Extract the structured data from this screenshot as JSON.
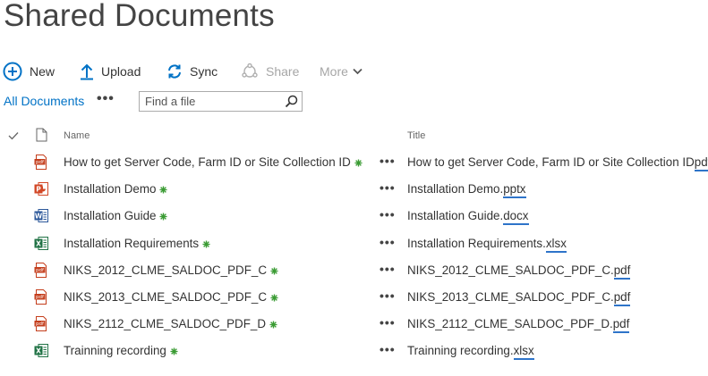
{
  "page": {
    "title": "Shared Documents"
  },
  "toolbar": {
    "new_label": "New",
    "upload_label": "Upload",
    "sync_label": "Sync",
    "share_label": "Share",
    "more_label": "More"
  },
  "view": {
    "all_documents": "All Documents",
    "more": "•••",
    "search_placeholder": "Find a file"
  },
  "columns": {
    "name": "Name",
    "title": "Title"
  },
  "colors": {
    "accent": "#0072c6",
    "new_marker": "#3a9b33",
    "ext_underline": "#2e74c9"
  },
  "files": [
    {
      "type": "pdf",
      "name": "How to get Server Code, Farm ID or Site Collection ID",
      "title_base": "How to get Server Code, Farm ID or Site Collection ID",
      "title_ext": "pdf"
    },
    {
      "type": "pptx",
      "name": "Installation Demo",
      "title_base": "Installation Demo.",
      "title_ext": "pptx"
    },
    {
      "type": "docx",
      "name": "Installation Guide",
      "title_base": "Installation Guide.",
      "title_ext": "docx"
    },
    {
      "type": "xlsx",
      "name": "Installation Requirements",
      "title_base": "Installation Requirements.",
      "title_ext": "xlsx"
    },
    {
      "type": "pdf",
      "name": "NIKS_2012_CLME_SALDOC_PDF_C",
      "title_base": "NIKS_2012_CLME_SALDOC_PDF_C.",
      "title_ext": "pdf"
    },
    {
      "type": "pdf",
      "name": "NIKS_2013_CLME_SALDOC_PDF_C",
      "title_base": "NIKS_2013_CLME_SALDOC_PDF_C.",
      "title_ext": "pdf"
    },
    {
      "type": "pdf",
      "name": "NIKS_2112_CLME_SALDOC_PDF_D",
      "title_base": "NIKS_2112_CLME_SALDOC_PDF_D.",
      "title_ext": "pdf"
    },
    {
      "type": "xlsx",
      "name": "Trainning recording",
      "title_base": "Trainning recording.",
      "title_ext": "xlsx"
    }
  ]
}
